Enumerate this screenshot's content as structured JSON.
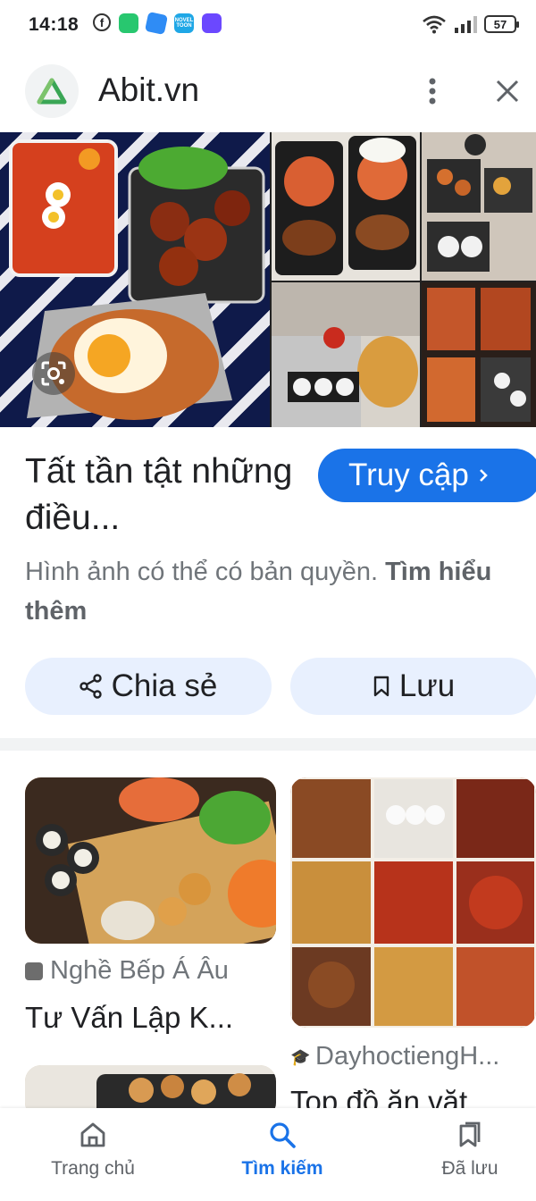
{
  "status_bar": {
    "time": "14:18",
    "battery": "57",
    "apps": [
      "facebook-icon",
      "green-app-icon",
      "blue-app-icon",
      "novel-toon-icon",
      "game-app-icon"
    ],
    "novel_label": "NOVEL TOON"
  },
  "header": {
    "site_name": "Abit.vn"
  },
  "result": {
    "title": "Tất tần tật những điều...",
    "visit_label": "Truy cập",
    "copyright_text": "Hình ảnh có thể có bản quyền.",
    "learn_more": "Tìm hiểu thêm",
    "share_label": "Chia sẻ",
    "save_label": "Lưu"
  },
  "related": [
    {
      "source": "Nghề Bếp Á Âu",
      "title": "Tư Vấn Lập K..."
    },
    {
      "source": "DayhoctiengH...",
      "title": "Top đồ ăn vặt"
    }
  ],
  "bottom_nav": {
    "home": "Trang chủ",
    "search": "Tìm kiếm",
    "saved": "Đã lưu"
  },
  "colors": {
    "accent": "#1a73e8",
    "chip_bg": "#e8f0fe",
    "secondary_text": "#70757a"
  }
}
